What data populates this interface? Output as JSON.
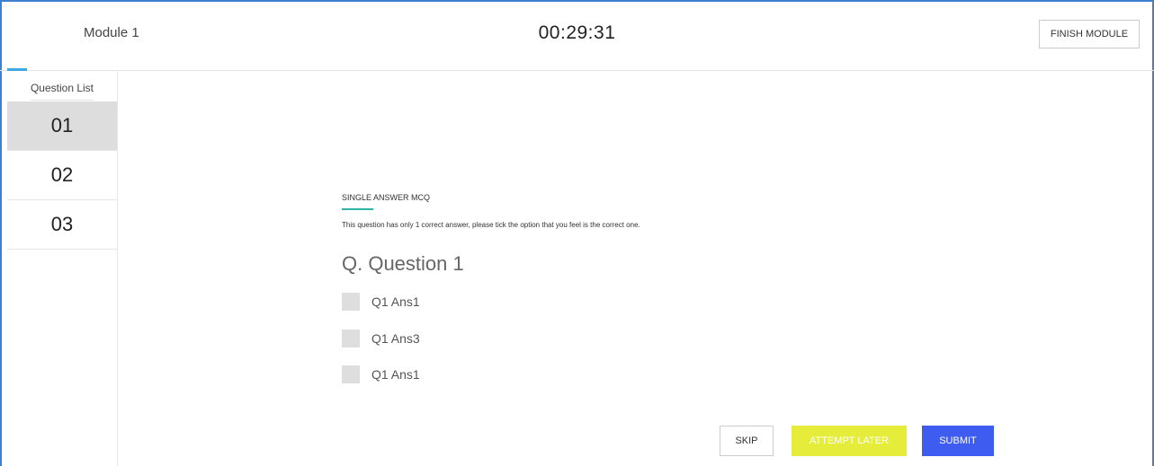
{
  "header": {
    "module_title": "Module 1",
    "timer": "00:29:31",
    "finish_label": "FINISH MODULE"
  },
  "sidebar": {
    "heading": "Question List",
    "items": [
      {
        "label": "01",
        "active": true
      },
      {
        "label": "02",
        "active": false
      },
      {
        "label": "03",
        "active": false
      }
    ]
  },
  "question": {
    "type": "SINGLE ANSWER MCQ",
    "instructions": "This question has only 1 correct answer, please tick the option that you feel is the correct one.",
    "title": "Q. Question 1",
    "options": [
      {
        "label": "Q1 Ans1",
        "checked": false
      },
      {
        "label": "Q1 Ans3",
        "checked": false
      },
      {
        "label": "Q1 Ans1",
        "checked": false
      }
    ]
  },
  "actions": {
    "skip_label": "SKIP",
    "attempt_later_label": "ATTEMPT LATER",
    "submit_label": "SUBMIT"
  },
  "colors": {
    "frame_border": "#3f7fcf",
    "active_item_bg": "#dddddd",
    "qtype_underline": "#2fb5a6",
    "attempt_later_bg": "#e5ec3a",
    "submit_bg": "#3f5cf0"
  }
}
